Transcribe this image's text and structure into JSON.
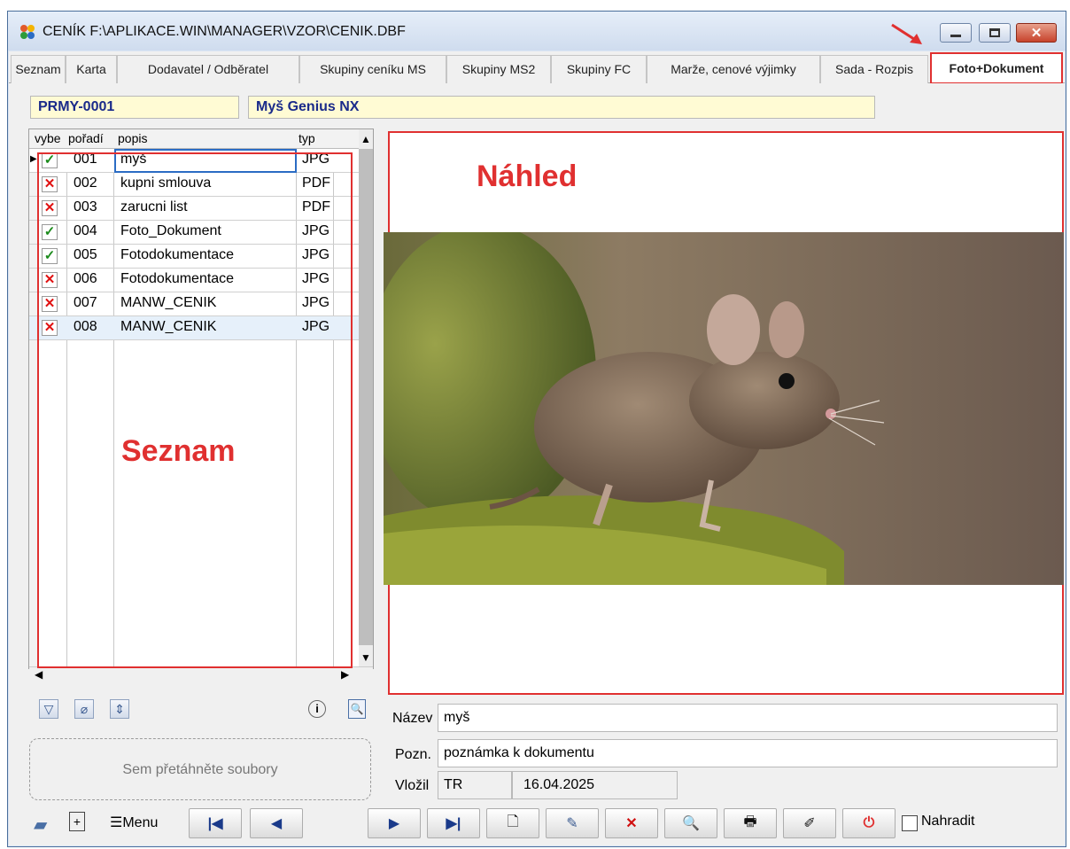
{
  "window": {
    "title": "CENÍK F:\\APLIKACE.WIN\\MANAGER\\VZOR\\CENIK.DBF"
  },
  "tabs": [
    {
      "label": "Seznam"
    },
    {
      "label": "Karta"
    },
    {
      "label": "Dodavatel / Odběratel"
    },
    {
      "label": "Skupiny ceníku MS"
    },
    {
      "label": "Skupiny MS2"
    },
    {
      "label": "Skupiny FC"
    },
    {
      "label": "Marže, cenové výjimky"
    },
    {
      "label": "Sada - Rozpis"
    },
    {
      "label": "Foto+Dokument"
    }
  ],
  "header": {
    "code": "PRMY-0001",
    "name": "Myš Genius NX"
  },
  "grid": {
    "columns": [
      "vybe",
      "pořadí",
      "popis",
      "typ"
    ],
    "rows": [
      {
        "selected": true,
        "order": "001",
        "desc": "myš",
        "type": "JPG"
      },
      {
        "selected": false,
        "order": "002",
        "desc": "kupni smlouva",
        "type": "PDF"
      },
      {
        "selected": false,
        "order": "003",
        "desc": "zarucni list",
        "type": "PDF"
      },
      {
        "selected": true,
        "order": "004",
        "desc": "Foto_Dokument",
        "type": "JPG"
      },
      {
        "selected": true,
        "order": "005",
        "desc": "Fotodokumentace",
        "type": "JPG"
      },
      {
        "selected": false,
        "order": "006",
        "desc": "Fotodokumentace",
        "type": "JPG"
      },
      {
        "selected": false,
        "order": "007",
        "desc": "MANW_CENIK",
        "type": "JPG"
      },
      {
        "selected": false,
        "order": "008",
        "desc": "MANW_CENIK",
        "type": "JPG"
      }
    ]
  },
  "annotations": {
    "list": "Seznam",
    "preview": "Náhled"
  },
  "dropzone": "Sem přetáhněte soubory",
  "fields": {
    "name_label": "Název",
    "name_value": "myš",
    "note_label": "Pozn.",
    "note_value": "poznámka k dokumentu",
    "inserted_label": "Vložil",
    "inserted_by": "TR",
    "inserted_date": "16.04.2025"
  },
  "toolbar": {
    "menu_label": "Menu",
    "replace_label": "Nahradit"
  },
  "colors": {
    "accent_red": "#e03030",
    "check_green": "#1c8b1c",
    "field_yellow": "#fffbd4"
  }
}
